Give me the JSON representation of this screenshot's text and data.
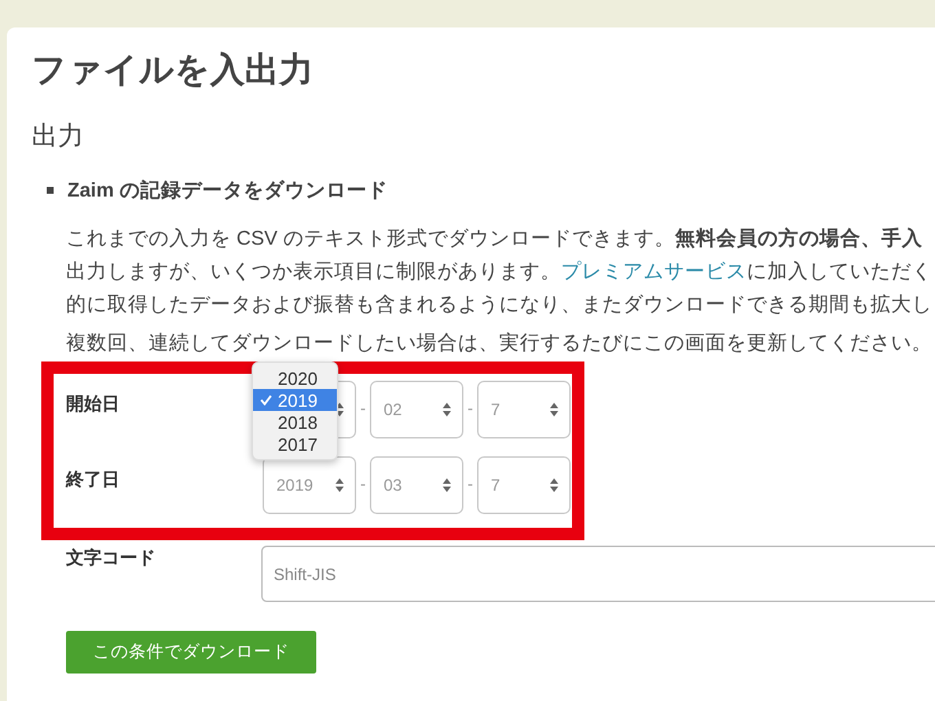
{
  "page_title": "ファイルを入出力",
  "section_title": "出力",
  "list_item": "Zaim の記録データをダウンロード",
  "paragraph": [
    [
      {
        "kind": "plain",
        "text": "これまでの入力を CSV のテキスト形式でダウンロードできます。"
      },
      {
        "kind": "bold",
        "text": "無料会員の方の場合、手入"
      }
    ],
    [
      {
        "kind": "plain",
        "text": "出力しますが、いくつか表示項目に制限があります。"
      },
      {
        "kind": "link",
        "text": "プレミアムサービス"
      },
      {
        "kind": "plain",
        "text": "に加入していただく"
      }
    ],
    [
      {
        "kind": "plain",
        "text": "的に取得したデータおよび振替も含まれるようになり、またダウンロードできる期間も拡大し"
      }
    ]
  ],
  "note": "複数回、連続してダウンロードしたい場合は、実行するたびにこの画面を更新してください。",
  "date_rows": [
    {
      "label": "開始日",
      "separators": [
        "-",
        "-"
      ],
      "fields": [
        {
          "kind": "open-dropdown",
          "options": [
            {
              "label": "2020",
              "selected": false
            },
            {
              "label": "2019",
              "selected": true
            },
            {
              "label": "2018",
              "selected": false
            },
            {
              "label": "2017",
              "selected": false
            }
          ]
        },
        {
          "kind": "select",
          "value": "02"
        },
        {
          "kind": "select",
          "value": "7"
        }
      ]
    },
    {
      "label": "終了日",
      "separators": [
        "-",
        "-"
      ],
      "fields": [
        {
          "kind": "select",
          "value": "2019"
        },
        {
          "kind": "select",
          "value": "03"
        },
        {
          "kind": "select",
          "value": "7"
        }
      ]
    }
  ],
  "encoding": {
    "label": "文字コード",
    "value": "Shift-JIS"
  },
  "download_button": "この条件でダウンロード"
}
